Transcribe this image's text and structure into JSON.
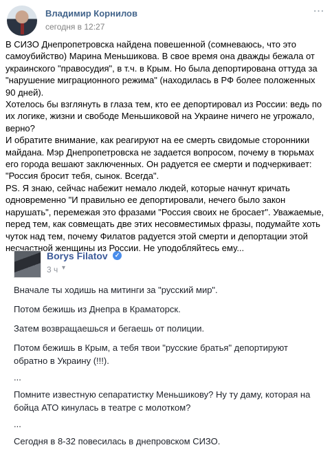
{
  "post": {
    "author": "Владимир Корнилов",
    "time": "сегодня в 12:27",
    "paragraphs": [
      "В СИЗО Днепропетровска найдена повешенной (сомневаюсь, что это самоубийство) Марина Меньшикова. В свое время она дважды бежала от украинского \"правосудия\", в т.ч. в Крым. Но была депортирована оттуда за \"нарушение миграционного режима\" (находилась в РФ более положенных 90 дней).",
      "Хотелось бы взглянуть в глаза тем, кто ее депортировал из России: ведь по их логике, жизни и свободе Меньшиковой на Украине ничего не угрожало, верно?",
      "И обратите внимание, как реагируют на ее смерть свидомые сторонники майдана. Мэр Днепропетровска не задается вопросом, почему в тюрьмах его города вешают заключенных. Он радуется ее смерти и подчеркивает: \"Россия бросит тебя, сынок. Всегда\".",
      "PS. Я знаю, сейчас набежит немало людей, которые начнут кричать одновременно \"И правильно ее депортировали, нечего было закон нарушать\", перемежая это фразами \"Россия своих не бросает\". Уважаемые, перед тем, как совмещать две этих несовместимых фразы, подумайте хоть чуток над тем, почему Филатов радуется этой смерти и депортации этой несчастной женщины из России. Не уподобляйтесь ему..."
    ]
  },
  "repost": {
    "author": "Borys Filatov",
    "time": "3 ч",
    "lines": [
      "Вначале ты ходишь на митинги за \"русский мир\".",
      "Потом бежишь из Днепра в Краматорск.",
      "Затем возвращаешься и бегаешь от полиции.",
      "Потом бежишь в Крым, а тебя твои \"русские братья\" депортируют обратно в Украину (!!!).",
      "...",
      "Помните известную сепаратистку Меньшикову? Ну ту даму, которая на бойца АТО кинулась в театре с молотком?",
      "...",
      "Сегодня в 8-32 повесилась в днепровском СИЗО."
    ]
  },
  "colors": {
    "vk_link": "#42648b",
    "fb_link": "#3b5998",
    "verified": "#4a8eec",
    "meta": "#828282"
  },
  "icons": [
    "more-icon",
    "verified-icon",
    "audience-caret-icon"
  ]
}
